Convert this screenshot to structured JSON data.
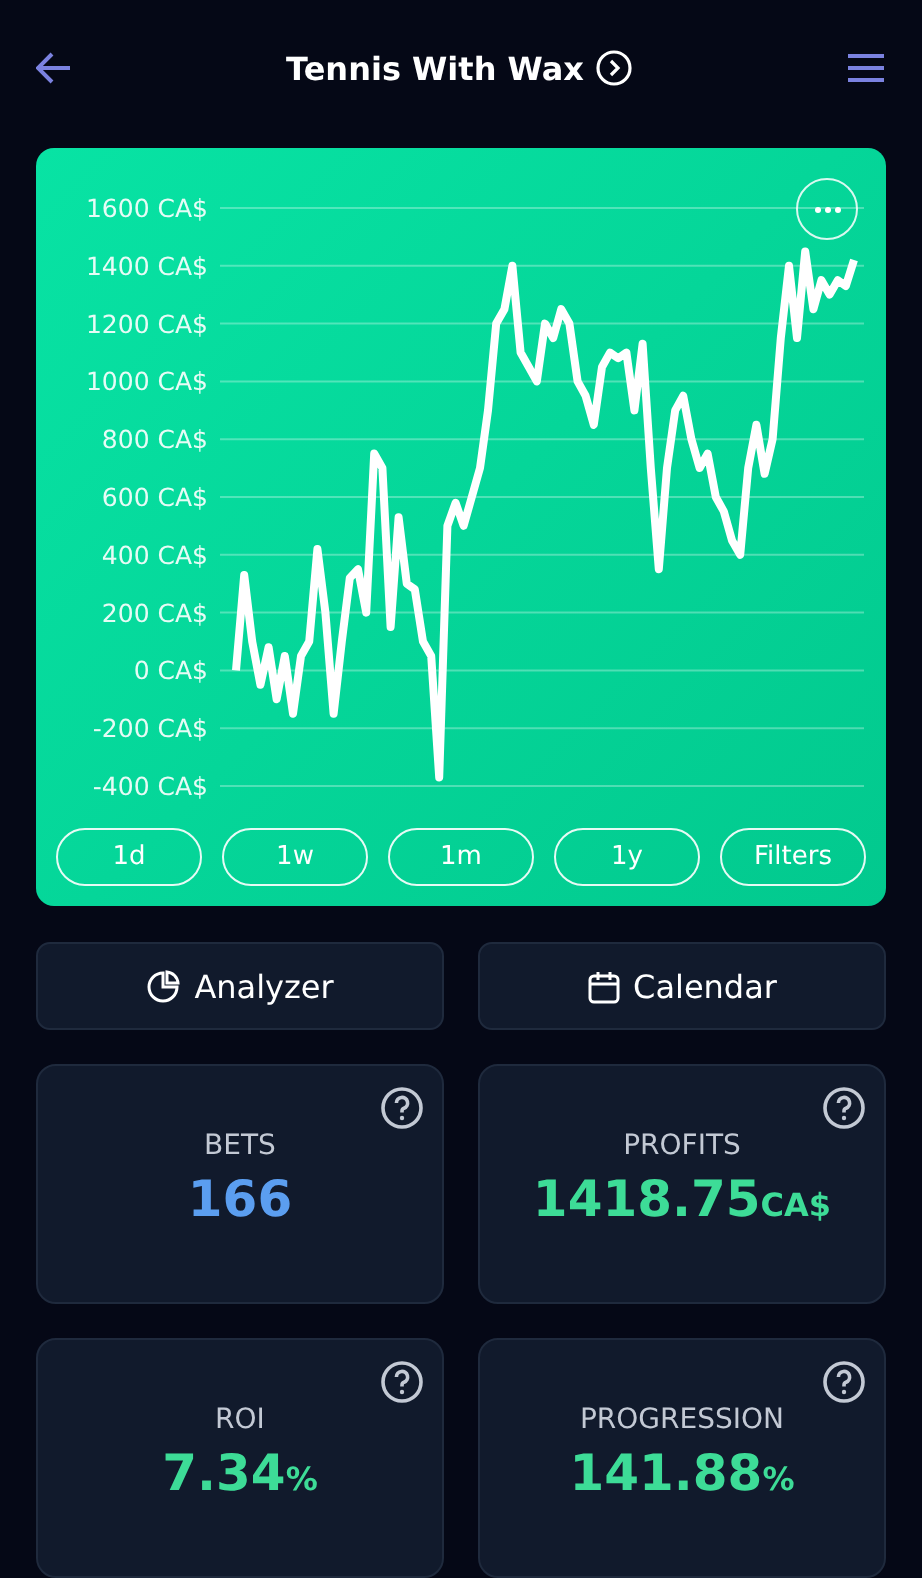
{
  "header": {
    "title": "Tennis With Wax"
  },
  "chart": {
    "chart_data": {
      "type": "line",
      "grid": true,
      "yticks": [
        {
          "value": 1600,
          "label": "1600 CA$"
        },
        {
          "value": 1400,
          "label": "1400 CA$"
        },
        {
          "value": 1200,
          "label": "1200 CA$"
        },
        {
          "value": 1000,
          "label": "1000 CA$"
        },
        {
          "value": 800,
          "label": "800 CA$"
        },
        {
          "value": 600,
          "label": "600 CA$"
        },
        {
          "value": 400,
          "label": "400 CA$"
        },
        {
          "value": 200,
          "label": "200 CA$"
        },
        {
          "value": 0,
          "label": "0 CA$"
        },
        {
          "value": -200,
          "label": "-200 CA$"
        },
        {
          "value": -400,
          "label": "-400 CA$"
        }
      ],
      "ylim": [
        -400,
        1600
      ],
      "series": [
        {
          "color": "#ffffff",
          "values": [
            0,
            330,
            100,
            -50,
            80,
            -100,
            50,
            -150,
            50,
            100,
            420,
            200,
            -150,
            100,
            320,
            350,
            200,
            750,
            700,
            150,
            530,
            300,
            280,
            100,
            50,
            -370,
            500,
            580,
            500,
            600,
            700,
            900,
            1200,
            1250,
            1400,
            1100,
            1050,
            1000,
            1200,
            1150,
            1250,
            1200,
            1000,
            950,
            850,
            1050,
            1100,
            1080,
            1100,
            900,
            1130,
            700,
            350,
            700,
            900,
            950,
            800,
            700,
            750,
            600,
            550,
            450,
            400,
            700,
            850,
            680,
            800,
            1150,
            1400,
            1150,
            1450,
            1250,
            1350,
            1300,
            1350,
            1330,
            1420
          ]
        }
      ]
    },
    "periods": [
      {
        "label": "1d"
      },
      {
        "label": "1w"
      },
      {
        "label": "1m"
      },
      {
        "label": "1y"
      },
      {
        "label": "Filters"
      }
    ]
  },
  "actions": [
    {
      "label": "Analyzer"
    },
    {
      "label": "Calendar"
    }
  ],
  "stats": [
    {
      "label": "BETS",
      "value": "166",
      "color": "#5b9ef0"
    },
    {
      "label": "PROFITS",
      "value": "1418.75",
      "unit": "CA$",
      "color": "#3ddc97"
    },
    {
      "label": "ROI",
      "value": "7.34",
      "unit": "%",
      "color": "#3ddc97"
    },
    {
      "label": "PROGRESSION",
      "value": "141.88",
      "unit": "%",
      "color": "#3ddc97"
    }
  ]
}
